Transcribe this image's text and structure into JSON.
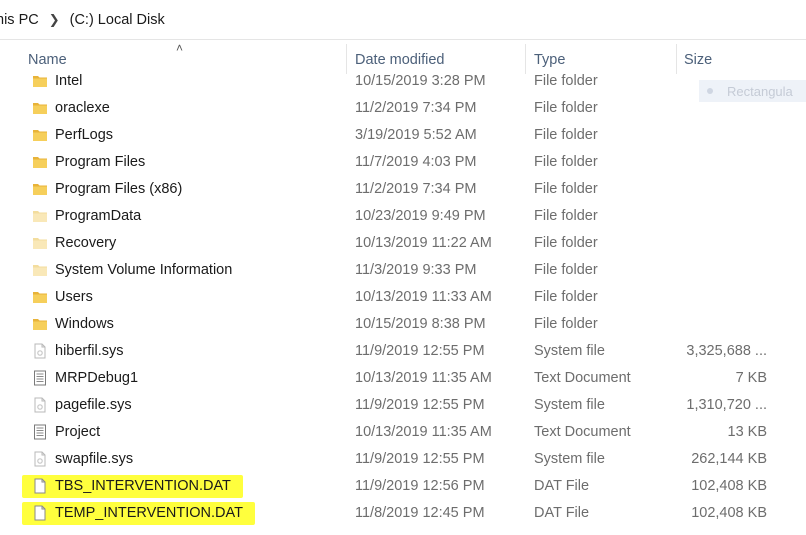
{
  "breadcrumb": [
    "his PC",
    "(C:) Local Disk"
  ],
  "columns": {
    "name": "Name",
    "date": "Date modified",
    "type": "Type",
    "size": "Size"
  },
  "ghost_label": "Rectangula",
  "rows": [
    {
      "name": "Intel",
      "date": "10/15/2019 3:28 PM",
      "type": "File folder",
      "size": "",
      "icon": "folder-icon"
    },
    {
      "name": "oraclexe",
      "date": "11/2/2019 7:34 PM",
      "type": "File folder",
      "size": "",
      "icon": "folder-icon"
    },
    {
      "name": "PerfLogs",
      "date": "3/19/2019 5:52 AM",
      "type": "File folder",
      "size": "",
      "icon": "folder-icon"
    },
    {
      "name": "Program Files",
      "date": "11/7/2019 4:03 PM",
      "type": "File folder",
      "size": "",
      "icon": "folder-icon"
    },
    {
      "name": "Program Files (x86)",
      "date": "11/2/2019 7:34 PM",
      "type": "File folder",
      "size": "",
      "icon": "folder-icon"
    },
    {
      "name": "ProgramData",
      "date": "10/23/2019 9:49 PM",
      "type": "File folder",
      "size": "",
      "icon": "folder-hidden-icon"
    },
    {
      "name": "Recovery",
      "date": "10/13/2019 11:22 AM",
      "type": "File folder",
      "size": "",
      "icon": "folder-hidden-icon"
    },
    {
      "name": "System Volume Information",
      "date": "11/3/2019 9:33 PM",
      "type": "File folder",
      "size": "",
      "icon": "folder-hidden-icon"
    },
    {
      "name": "Users",
      "date": "10/13/2019 11:33 AM",
      "type": "File folder",
      "size": "",
      "icon": "folder-icon"
    },
    {
      "name": "Windows",
      "date": "10/15/2019 8:38 PM",
      "type": "File folder",
      "size": "",
      "icon": "folder-icon"
    },
    {
      "name": "hiberfil.sys",
      "date": "11/9/2019 12:55 PM",
      "type": "System file",
      "size": "3,325,688 ...",
      "icon": "system-file-icon"
    },
    {
      "name": "MRPDebug1",
      "date": "10/13/2019 11:35 AM",
      "type": "Text Document",
      "size": "7 KB",
      "icon": "text-file-icon"
    },
    {
      "name": "pagefile.sys",
      "date": "11/9/2019 12:55 PM",
      "type": "System file",
      "size": "1,310,720 ...",
      "icon": "system-file-icon"
    },
    {
      "name": "Project",
      "date": "10/13/2019 11:35 AM",
      "type": "Text Document",
      "size": "13 KB",
      "icon": "text-file-icon"
    },
    {
      "name": "swapfile.sys",
      "date": "11/9/2019 12:55 PM",
      "type": "System file",
      "size": "262,144 KB",
      "icon": "system-file-icon"
    },
    {
      "name": "TBS_INTERVENTION.DAT",
      "date": "11/9/2019 12:56 PM",
      "type": "DAT File",
      "size": "102,408 KB",
      "icon": "blank-file-icon",
      "highlight": true
    },
    {
      "name": "TEMP_INTERVENTION.DAT",
      "date": "11/8/2019 12:45 PM",
      "type": "DAT File",
      "size": "102,408 KB",
      "icon": "blank-file-icon",
      "highlight": true
    }
  ],
  "colors": {
    "highlight": "#ffff3d",
    "folder": "#f0c24a",
    "header_text": "#4c607a"
  }
}
